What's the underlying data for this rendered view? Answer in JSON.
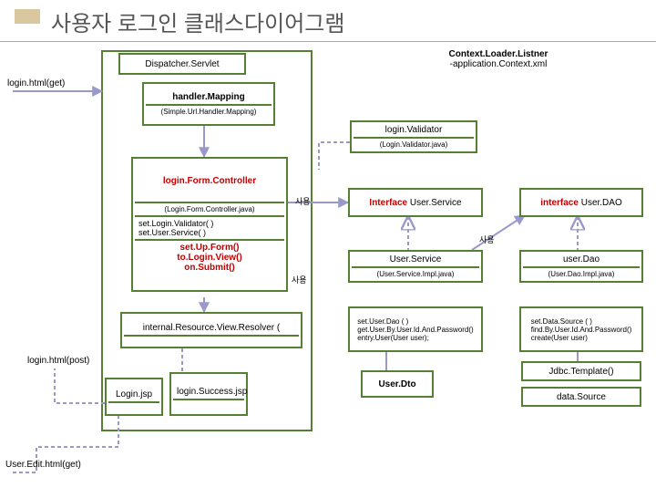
{
  "title": "사용자 로그인 클래스다이어그램",
  "dispatcher": "Dispatcher.Servlet",
  "contextLoader": {
    "name": "Context.Loader.Listner",
    "sub": "-application.Context.xml"
  },
  "entry": {
    "loginGet": "login.html(get)",
    "loginPost": "login.html(post)",
    "userEditGet": "User.Edit.html(get)"
  },
  "handlerMapping": {
    "name": "handler.Mapping",
    "impl": "(Simple.Url.Handler.Mapping)"
  },
  "loginValidator": {
    "name": "login.Validator",
    "impl": "(Login.Validator.java)"
  },
  "loginFormController": {
    "name": "login.Form.Controller",
    "impl": "(Login.Form.Controller.java)",
    "methods1": "set.Login.Validator( )\nset.User.Service( )",
    "methods2": "set.Up.Form()\nto.Login.View()\non.Submit()"
  },
  "viewResolver": "internal.Resource.View.Resolver (",
  "jsp": {
    "login": "Login.jsp",
    "success": "login.Success.jsp"
  },
  "interfaceUserService": {
    "prefix": "Interface ",
    "name": "User.Service"
  },
  "userService": {
    "name": "User.Service",
    "impl": "(User.Service.Impl.java)",
    "methods": "set.User.Dao ( )\nget.User.By.User.Id.And.Password()\nentry.User(User user);"
  },
  "interfaceUserDao": {
    "prefix": "interface ",
    "name": "User.DAO"
  },
  "userDao": {
    "name": "user.Dao",
    "impl": "(User.Dao.Impl.java)",
    "methods": "set.Data.Source ( )\nfind.By.User.Id.And.Password()\ncreate(User user)"
  },
  "userDto": "User.Dto",
  "jdbc": "Jdbc.Template()",
  "dataSource": "data.Source",
  "useLabel": "사용"
}
